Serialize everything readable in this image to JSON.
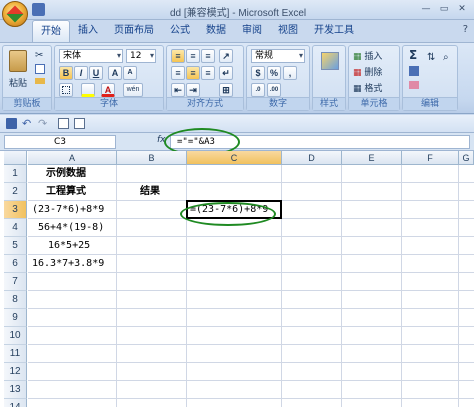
{
  "window": {
    "title": "dd  [兼容模式] - Microsoft Excel",
    "minimize": "—",
    "restore": "▭",
    "close": "✕"
  },
  "ribbon": {
    "tabs": [
      "开始",
      "插入",
      "页面布局",
      "公式",
      "数据",
      "审阅",
      "视图",
      "开发工具"
    ],
    "help": "?",
    "clipboard": {
      "label": "剪贴板",
      "paste": "粘贴"
    },
    "font": {
      "label": "字体",
      "name": "宋体",
      "size": "12",
      "bold": "B",
      "italic": "I",
      "underline": "U",
      "grow": "A",
      "shrink": "A",
      "color": "A",
      "change_case": "wén"
    },
    "alignment": {
      "label": "对齐方式"
    },
    "number": {
      "label": "数字",
      "format": "常规",
      "percent": "%",
      "comma": ",",
      "currency": "$"
    },
    "styles": {
      "label": "样式"
    },
    "cells": {
      "label": "单元格",
      "insert": "插入",
      "delete": "删除",
      "format": "格式"
    },
    "editing": {
      "label": "编辑",
      "sum": "Σ"
    }
  },
  "formula_bar": {
    "name_box": "C3",
    "fx": "fx",
    "formula": "=\"=\"&A3"
  },
  "columns": [
    "A",
    "B",
    "C",
    "D",
    "E",
    "F",
    "G"
  ],
  "rows": [
    "1",
    "2",
    "3",
    "4",
    "5",
    "6",
    "7",
    "8",
    "9",
    "10",
    "11",
    "12",
    "13",
    "14"
  ],
  "selected_cell": {
    "column": "C",
    "row": "3"
  },
  "cells": {
    "A1": "示例数据",
    "A2": "工程算式",
    "B2": "结果",
    "A3": "(23-7*6)+8*9",
    "C3": "=(23-7*6)+8*9",
    "A4": "56+4*(19-8)",
    "A5": "16*5+25",
    "A6": "16.3*7+3.8*9"
  },
  "colors": {
    "highlight_ellipse": "#1f8a22",
    "selected_header": "#f1c15f"
  }
}
